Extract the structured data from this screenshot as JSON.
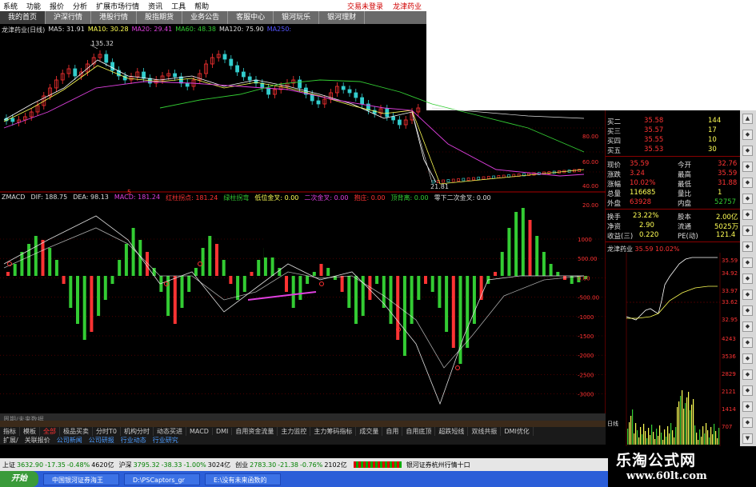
{
  "menu": {
    "items": [
      "系统",
      "功能",
      "报价",
      "分析",
      "扩展市场行情",
      "资讯",
      "工具",
      "帮助"
    ],
    "status_login": "交易未登录",
    "status_stock": "龙津药业"
  },
  "nav": {
    "items": [
      "我的首页",
      "沪深行情",
      "港股行情",
      "股指期货",
      "业务公告",
      "客服中心",
      "银河玩乐",
      "银河理财"
    ]
  },
  "ma_legend": {
    "stock": "龙津药业(日线)",
    "ma5": "MA5: 31.91",
    "ma10": "MA10: 30.28",
    "ma20": "MA20: 29.41",
    "ma60": "MA60: 48.38",
    "ma120": "MA120: 75.90",
    "extra": "MA250:"
  },
  "price_annotations": {
    "high": "135.32",
    "low": "21.81",
    "marker": "5"
  },
  "price_axis": [
    "80.00",
    "60.00",
    "40.00",
    "20.00"
  ],
  "macd_legend": {
    "name": "ZMACD",
    "dif": "DIF: 188.75",
    "dea": "DEA: 98.13",
    "macd": "MACD: 181.24",
    "hongzhu": "红柱拐点: 181.24",
    "lvzhu": "绿柱拐弯",
    "dixian": "低位金叉: 0.00",
    "erci": "二次金叉: 0.00",
    "jiazhu": "抱庄: 0.00",
    "shoupan": "顶背离: 0.00",
    "lingxia": "零下二次金叉: 0.00"
  },
  "macd_axis": [
    "1000",
    "500.00",
    "0.00",
    "-500.00",
    "-1000",
    "-1500",
    "-2000",
    "-2500",
    "-3000"
  ],
  "date_label": "周期/未来数据",
  "tabs1": [
    "指标",
    "模板",
    "全部",
    "极品买卖",
    "分时T0",
    "机构分时",
    "动态买进",
    "MACD",
    "DMI",
    "自用资金流量",
    "主力监控",
    "主力筹码指标",
    "成交量",
    "自用",
    "自用底顶",
    "超跌短线",
    "双线共振",
    "DMI优化"
  ],
  "tabs1_active": "全部",
  "tabs2": [
    "扩展/",
    "关联报价",
    "公司新闻",
    "公司研报",
    "行业动态",
    "行业研究"
  ],
  "quote": {
    "rows": [
      {
        "label": "买二",
        "price": "35.58",
        "vol": "144"
      },
      {
        "label": "买三",
        "price": "35.57",
        "vol": "17"
      },
      {
        "label": "买四",
        "price": "35.55",
        "vol": "10"
      },
      {
        "label": "买五",
        "price": "35.53",
        "vol": "30"
      }
    ],
    "stats": [
      {
        "l1": "现价",
        "v1": "35.59",
        "l2": "今开",
        "v2": "32.76"
      },
      {
        "l1": "涨跌",
        "v1": "3.24",
        "l2": "最高",
        "v2": "35.59"
      },
      {
        "l1": "涨幅",
        "v1": "10.02%",
        "l2": "最低",
        "v2": "31.88"
      },
      {
        "l1": "总量",
        "v1": "116685",
        "l2": "量比",
        "v2": "1"
      },
      {
        "l1": "外盘",
        "v1": "63928",
        "l2": "内盘",
        "v2": "52757"
      },
      {
        "l1": "换手",
        "v1": "23.22%",
        "l2": "股本",
        "v2": "2.00亿"
      },
      {
        "l1": "净资",
        "v1": "2.90",
        "l2": "流通",
        "v2": "5025万"
      },
      {
        "l1": "收益(三)",
        "v1": "0.220",
        "l2": "PE(动)",
        "v2": "121.4"
      }
    ],
    "mini_title": "龙津药业",
    "mini_price": "35.59",
    "mini_pct": "10.02%",
    "mini_axis": [
      "35.59",
      "34.92",
      "33.97",
      "33.62",
      "32.95"
    ],
    "mini_vol_axis": [
      "4243",
      "3536",
      "2829",
      "2121",
      "1414",
      "707"
    ],
    "mini_vol_label": "日线"
  },
  "indexbar": {
    "sh": "上证",
    "sh_val": "3632.90",
    "sh_chg": "-17.35",
    "sh_pct": "-0.48%",
    "sh_amt": "4620亿",
    "sz": "沪深",
    "sz_val": "3795.32",
    "sz_chg": "-38.33",
    "sz_pct": "-1.00%",
    "sz_amt": "3024亿",
    "cy": "创业",
    "cy_val": "2783.30",
    "cy_chg": "-21.38",
    "cy_pct": "-0.76%",
    "cy_amt": "2102亿",
    "right": "银河证券杭州行情十口"
  },
  "taskbar": {
    "start": "开始",
    "tasks": [
      "中国银河证券海王",
      "D:\\PSCaptors_gr",
      "E:\\没有未来函数的"
    ]
  },
  "watermark": {
    "line1": "乐淘公式网",
    "line2": "www.60lt.com"
  }
}
